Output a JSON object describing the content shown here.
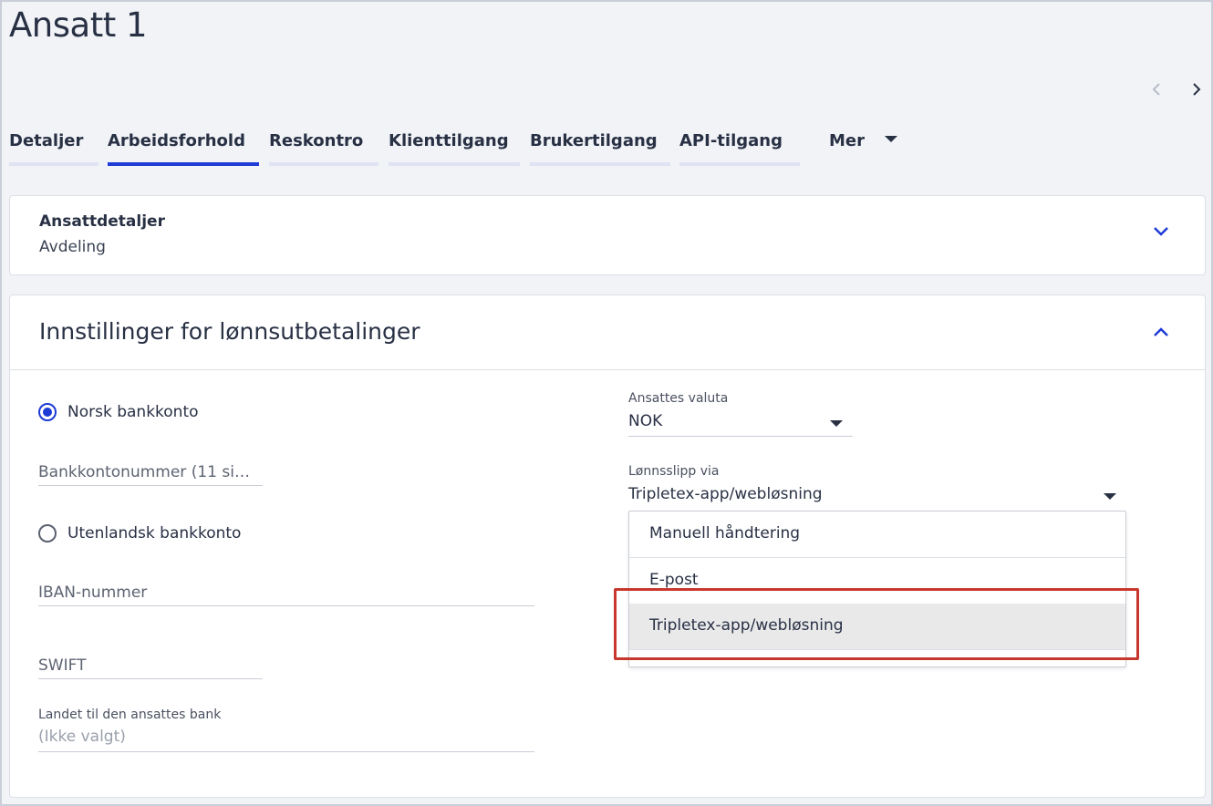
{
  "page": {
    "title": "Ansatt 1"
  },
  "nav": {
    "prev_icon": "chevron-left-icon",
    "next_icon": "chevron-right-icon"
  },
  "tabs": [
    {
      "label": "Detaljer",
      "active": false
    },
    {
      "label": "Arbeidsforhold",
      "active": true
    },
    {
      "label": "Reskontro",
      "active": false
    },
    {
      "label": "Klienttilgang",
      "active": false
    },
    {
      "label": "Brukertilgang",
      "active": false
    },
    {
      "label": "API-tilgang",
      "active": false
    }
  ],
  "more_tab": {
    "label": "Mer"
  },
  "employee_details": {
    "title": "Ansattdetaljer",
    "subtitle": "Avdeling"
  },
  "payroll_settings": {
    "title": "Innstillinger for lønnsutbetalinger",
    "norwegian_account": {
      "label": "Norsk bankkonto",
      "checked": true
    },
    "account_number": {
      "placeholder": "Bankkontonummer (11 si…"
    },
    "foreign_account": {
      "label": "Utenlandsk bankkonto",
      "checked": false
    },
    "iban": {
      "placeholder": "IBAN-nummer"
    },
    "swift": {
      "placeholder": "SWIFT"
    },
    "bank_country": {
      "label": "Landet til den ansattes bank",
      "value": "(Ikke valgt)"
    },
    "currency": {
      "label": "Ansattes valuta",
      "value": "NOK"
    },
    "payslip": {
      "label": "Lønnsslipp via",
      "value": "Tripletex-app/webløsning",
      "options": [
        {
          "label": "Manuell håndtering",
          "selected": false
        },
        {
          "label": "E-post",
          "selected": false
        },
        {
          "label": "Tripletex-app/webløsning",
          "selected": true
        }
      ]
    }
  },
  "colors": {
    "accent": "#1e3bd6",
    "highlight": "#c8372d",
    "text": "#283044",
    "background": "#f1f3f7"
  }
}
